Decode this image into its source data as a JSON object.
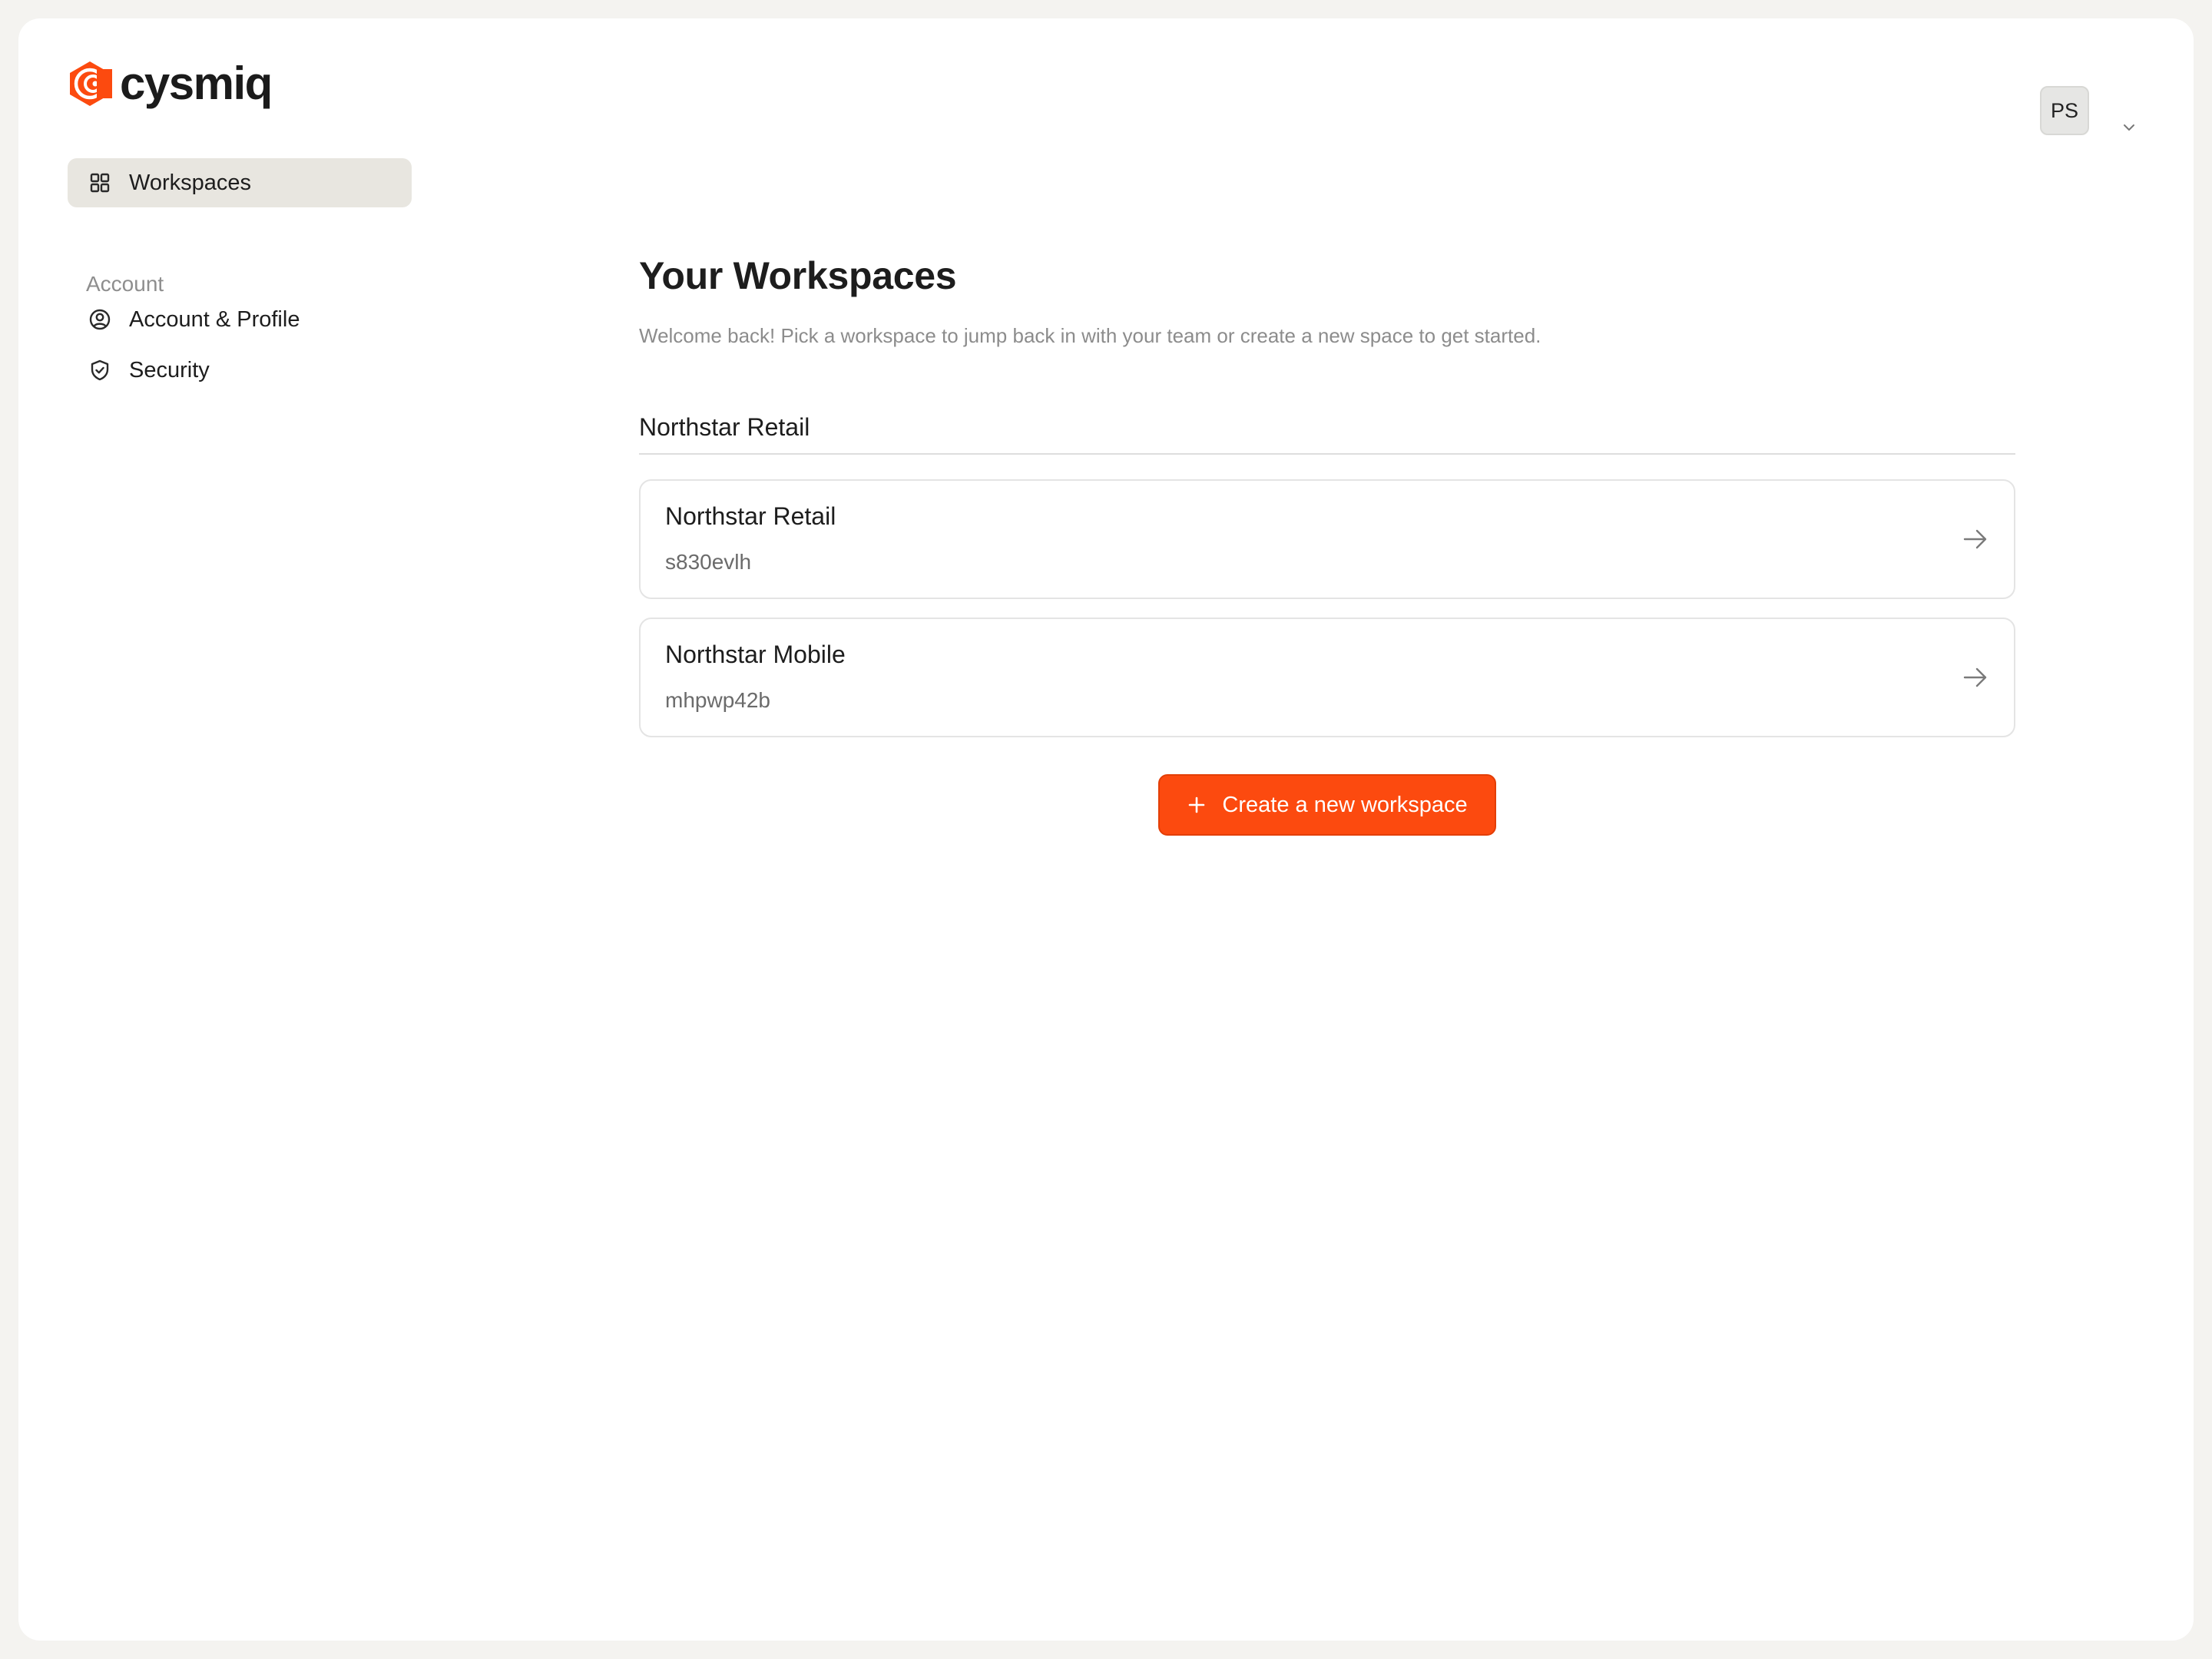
{
  "app": {
    "logo_text": "cysmiq",
    "brand_color": "#fc4a0f"
  },
  "sidebar": {
    "items": [
      {
        "label": "Workspaces",
        "icon": "grid-icon",
        "active": true
      }
    ],
    "account_section": {
      "label": "Account",
      "items": [
        {
          "label": "Account & Profile",
          "icon": "user-circle-icon"
        },
        {
          "label": "Security",
          "icon": "shield-check-icon"
        }
      ]
    }
  },
  "user_menu": {
    "initials": "PS",
    "icon": "chevron-down-icon"
  },
  "main": {
    "title": "Your Workspaces",
    "subtitle": "Welcome back! Pick a workspace to jump back in with your team or create a new space to get started.",
    "groups": [
      {
        "name": "Northstar Retail",
        "workspaces": [
          {
            "name": "Northstar Retail",
            "id": "s830evlh",
            "icon": "arrow-right-icon"
          },
          {
            "name": "Northstar Mobile",
            "id": "mhpwp42b",
            "icon": "arrow-right-icon"
          }
        ]
      }
    ],
    "create_button": {
      "label": "Create a new workspace",
      "icon": "plus-icon"
    }
  }
}
